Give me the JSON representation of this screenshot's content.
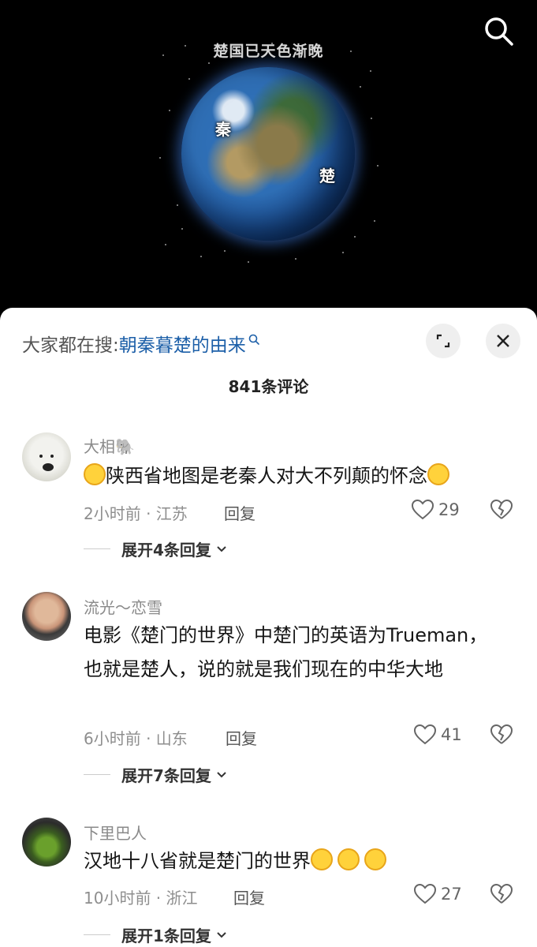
{
  "video": {
    "title": "楚国已天色渐晚",
    "label_qin": "秦",
    "label_chu": "楚",
    "search_icon": "search-icon"
  },
  "sheet": {
    "trend_prefix": "大家都在搜:",
    "trend_keyword": "朝秦暮楚的由来",
    "comment_count": "841条评论",
    "expand_icon": "expand-icon",
    "close_icon": "close-icon"
  },
  "comments": [
    {
      "username": "大相🐘",
      "text": "陕西省地图是老秦人对大不列颠的怀念",
      "time_loc": "2小时前 · 江苏",
      "reply": "回复",
      "likes": "29",
      "expand": "展开4条回复"
    },
    {
      "username": "流光～恋雪",
      "text": "电影《楚门的世界》中楚门的英语为Trueman， 也就是楚人，说的就是我们现在的中华大地",
      "time_loc": "6小时前 · 山东",
      "reply": "回复",
      "likes": "41",
      "expand": "展开7条回复"
    },
    {
      "username": "下里巴人",
      "text": "汉地十八省就是楚门的世界",
      "time_loc": "10小时前 · 浙江",
      "reply": "回复",
      "likes": "27",
      "expand": "展开1条回复"
    }
  ],
  "colors": {
    "keyword": "#1c5fa8",
    "sheet_bg": "#ffffff",
    "video_bg": "#000000"
  }
}
